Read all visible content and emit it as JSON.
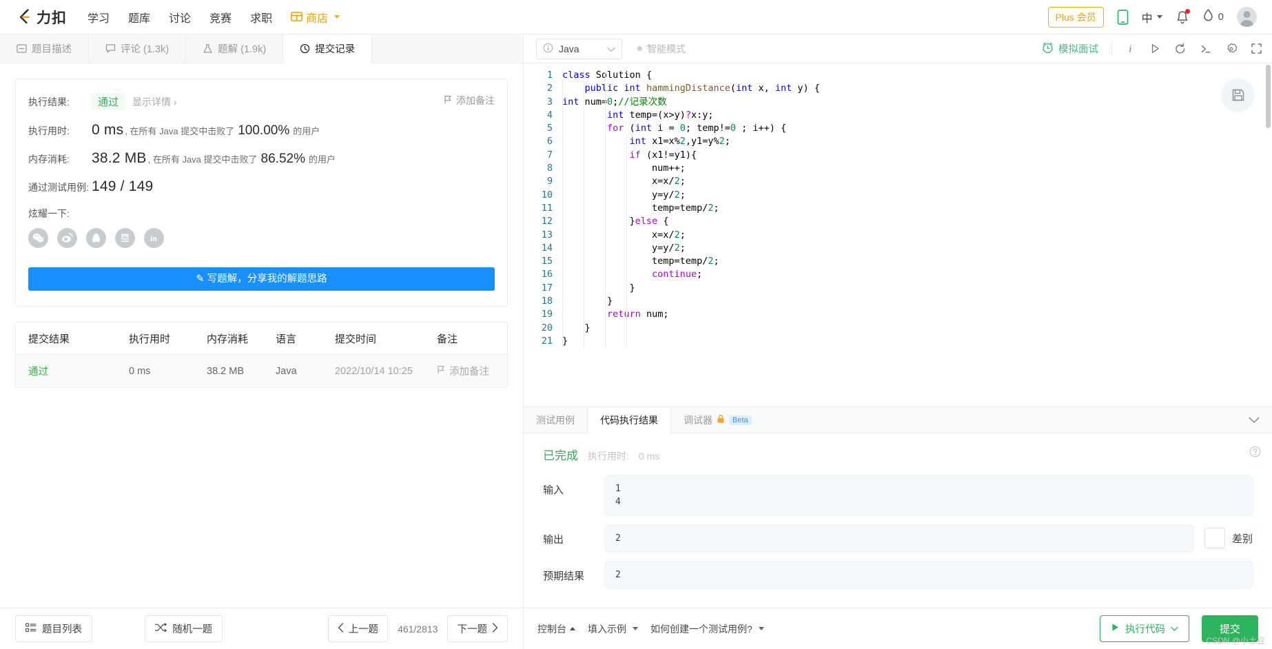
{
  "header": {
    "brand": "力扣",
    "nav": [
      {
        "label": "学习",
        "icon": null
      },
      {
        "label": "题库",
        "icon": null
      },
      {
        "label": "讨论",
        "icon": null
      },
      {
        "label": "竞赛",
        "icon": null
      },
      {
        "label": "求职",
        "icon": null
      },
      {
        "label": "商店",
        "icon": "shop-icon"
      }
    ],
    "plus_badge": "Plus 会员",
    "mobile_icon": "mobile-icon",
    "language": "中",
    "bell_icon": "bell-icon",
    "streak_icon": "flame-icon",
    "streak_count": "0",
    "avatar_icon": "avatar-icon"
  },
  "left_tabs": [
    {
      "label": "题目描述",
      "icon": "description-icon",
      "active": false
    },
    {
      "label": "评论 (1.3k)",
      "icon": "comment-icon",
      "active": false
    },
    {
      "label": "题解 (1.9k)",
      "icon": "flask-icon",
      "active": false
    },
    {
      "label": "提交记录",
      "icon": "clock-icon",
      "active": true
    }
  ],
  "result": {
    "exec_result_label": "执行结果:",
    "status": "通过",
    "detail_link": "显示详情",
    "add_note": "添加备注",
    "runtime_label": "执行用时:",
    "runtime_value": "0 ms",
    "runtime_mid": ", 在所有 Java 提交中击败了",
    "runtime_pct": "100.00%",
    "runtime_suffix": "的用户",
    "memory_label": "内存消耗:",
    "memory_value": "38.2 MB",
    "memory_mid": ", 在所有 Java 提交中击败了",
    "memory_pct": "86.52%",
    "memory_suffix": "的用户",
    "testcases_label": "通过测试用例:",
    "testcases_value": "149 / 149",
    "share_label": "炫耀一下:",
    "share_icons": [
      "wechat-icon",
      "weibo-icon",
      "qq-icon",
      "douban-icon",
      "linkedin-icon"
    ],
    "write_solution_btn": "写题解，分享我的解题思路"
  },
  "submissions": {
    "columns": [
      "提交结果",
      "执行用时",
      "内存消耗",
      "语言",
      "提交时间",
      "备注"
    ],
    "rows": [
      {
        "status": "通过",
        "runtime": "0 ms",
        "memory": "38.2 MB",
        "language": "Java",
        "time": "2022/10/14 10:25",
        "note": "添加备注"
      }
    ]
  },
  "editor": {
    "language": "Java",
    "smart_mode": "智能模式",
    "mock_interview": "模拟面试",
    "tool_icons": [
      "info-icon",
      "play-icon",
      "reset-icon",
      "console-icon",
      "settings-icon",
      "fullscreen-icon"
    ],
    "save_icon": "save-icon",
    "code_lines": [
      {
        "n": 1,
        "tokens": [
          {
            "t": "class ",
            "c": "kw"
          },
          {
            "t": "Solution ",
            "c": "pl"
          },
          {
            "t": "{",
            "c": "pl"
          }
        ]
      },
      {
        "n": 2,
        "tokens": [
          {
            "t": "    ",
            "c": "pl"
          },
          {
            "t": "public ",
            "c": "kw"
          },
          {
            "t": "int ",
            "c": "kw"
          },
          {
            "t": "hammingDistance",
            "c": "fn"
          },
          {
            "t": "(",
            "c": "pl"
          },
          {
            "t": "int ",
            "c": "kw"
          },
          {
            "t": "x, ",
            "c": "pl"
          },
          {
            "t": "int ",
            "c": "kw"
          },
          {
            "t": "y) {",
            "c": "pl"
          }
        ]
      },
      {
        "n": 3,
        "tokens": [
          {
            "t": "int ",
            "c": "kw"
          },
          {
            "t": "num=",
            "c": "pl"
          },
          {
            "t": "0",
            "c": "num"
          },
          {
            "t": ";",
            "c": "pl"
          },
          {
            "t": "//记录次数",
            "c": "cm"
          }
        ]
      },
      {
        "n": 4,
        "tokens": [
          {
            "t": "        ",
            "c": "pl"
          },
          {
            "t": "int ",
            "c": "kw"
          },
          {
            "t": "temp=(x>y)",
            "c": "pl"
          },
          {
            "t": "?",
            "c": "kw2"
          },
          {
            "t": "x:y;",
            "c": "pl"
          }
        ]
      },
      {
        "n": 5,
        "tokens": [
          {
            "t": "        ",
            "c": "pl"
          },
          {
            "t": "for ",
            "c": "kw2"
          },
          {
            "t": "(",
            "c": "pl"
          },
          {
            "t": "int ",
            "c": "kw"
          },
          {
            "t": "i = ",
            "c": "pl"
          },
          {
            "t": "0",
            "c": "num"
          },
          {
            "t": "; temp!=",
            "c": "pl"
          },
          {
            "t": "0",
            "c": "num"
          },
          {
            "t": " ; i++) {",
            "c": "pl"
          }
        ]
      },
      {
        "n": 6,
        "tokens": [
          {
            "t": "            ",
            "c": "pl"
          },
          {
            "t": "int ",
            "c": "kw"
          },
          {
            "t": "x1=x%",
            "c": "pl"
          },
          {
            "t": "2",
            "c": "num"
          },
          {
            "t": ",y1=y%",
            "c": "pl"
          },
          {
            "t": "2",
            "c": "num"
          },
          {
            "t": ";",
            "c": "pl"
          }
        ]
      },
      {
        "n": 7,
        "tokens": [
          {
            "t": "            ",
            "c": "pl"
          },
          {
            "t": "if ",
            "c": "kw2"
          },
          {
            "t": "(x1!=y1){",
            "c": "pl"
          }
        ]
      },
      {
        "n": 8,
        "tokens": [
          {
            "t": "                num++;",
            "c": "pl"
          }
        ]
      },
      {
        "n": 9,
        "tokens": [
          {
            "t": "                x=x/",
            "c": "pl"
          },
          {
            "t": "2",
            "c": "num"
          },
          {
            "t": ";",
            "c": "pl"
          }
        ]
      },
      {
        "n": 10,
        "tokens": [
          {
            "t": "                y=y/",
            "c": "pl"
          },
          {
            "t": "2",
            "c": "num"
          },
          {
            "t": ";",
            "c": "pl"
          }
        ]
      },
      {
        "n": 11,
        "tokens": [
          {
            "t": "                temp=temp/",
            "c": "pl"
          },
          {
            "t": "2",
            "c": "num"
          },
          {
            "t": ";",
            "c": "pl"
          }
        ]
      },
      {
        "n": 12,
        "tokens": [
          {
            "t": "            }",
            "c": "pl"
          },
          {
            "t": "else ",
            "c": "kw2"
          },
          {
            "t": "{",
            "c": "pl"
          }
        ]
      },
      {
        "n": 13,
        "tokens": [
          {
            "t": "                x=x/",
            "c": "pl"
          },
          {
            "t": "2",
            "c": "num"
          },
          {
            "t": ";",
            "c": "pl"
          }
        ]
      },
      {
        "n": 14,
        "tokens": [
          {
            "t": "                y=y/",
            "c": "pl"
          },
          {
            "t": "2",
            "c": "num"
          },
          {
            "t": ";",
            "c": "pl"
          }
        ]
      },
      {
        "n": 15,
        "tokens": [
          {
            "t": "                temp=temp/",
            "c": "pl"
          },
          {
            "t": "2",
            "c": "num"
          },
          {
            "t": ";",
            "c": "pl"
          }
        ]
      },
      {
        "n": 16,
        "tokens": [
          {
            "t": "                ",
            "c": "pl"
          },
          {
            "t": "continue",
            "c": "kw2"
          },
          {
            "t": ";",
            "c": "pl"
          }
        ]
      },
      {
        "n": 17,
        "tokens": [
          {
            "t": "            }",
            "c": "pl"
          }
        ]
      },
      {
        "n": 18,
        "tokens": [
          {
            "t": "        }",
            "c": "pl"
          }
        ]
      },
      {
        "n": 19,
        "tokens": [
          {
            "t": "        ",
            "c": "pl"
          },
          {
            "t": "return ",
            "c": "kw2"
          },
          {
            "t": "num;",
            "c": "pl"
          }
        ]
      },
      {
        "n": 20,
        "tokens": [
          {
            "t": "    }",
            "c": "pl"
          }
        ]
      },
      {
        "n": 21,
        "tokens": [
          {
            "t": "}",
            "c": "pl"
          }
        ]
      }
    ]
  },
  "console": {
    "tabs": [
      {
        "label": "测试用例",
        "active": false,
        "badge": null
      },
      {
        "label": "代码执行结果",
        "active": true,
        "badge": null
      },
      {
        "label": "调试器",
        "active": false,
        "badge": "Beta",
        "lock": "lock-icon"
      }
    ],
    "status": "已完成",
    "runtime_label": "执行用时:",
    "runtime_value": "0 ms",
    "input_label": "输入",
    "input_value": "1\n4",
    "output_label": "输出",
    "output_value": "2",
    "diff_label": "差别",
    "expected_label": "预期结果",
    "expected_value": "2"
  },
  "bottom_left": {
    "problem_list": "题目列表",
    "random": "随机一题",
    "prev": "上一题",
    "counter": "461/2813",
    "next": "下一题"
  },
  "bottom_right": {
    "console_toggle": "控制台",
    "fill_example": "填入示例",
    "how_to_create": "如何创建一个测试用例?",
    "run_code": "执行代码",
    "submit": "提交"
  },
  "watermark": "CSDN @小土豆",
  "colors": {
    "brand_orange": "#f0a202",
    "primary_blue": "#1890ff",
    "success_green": "#2db55d",
    "pass_green": "#3ab54a"
  }
}
